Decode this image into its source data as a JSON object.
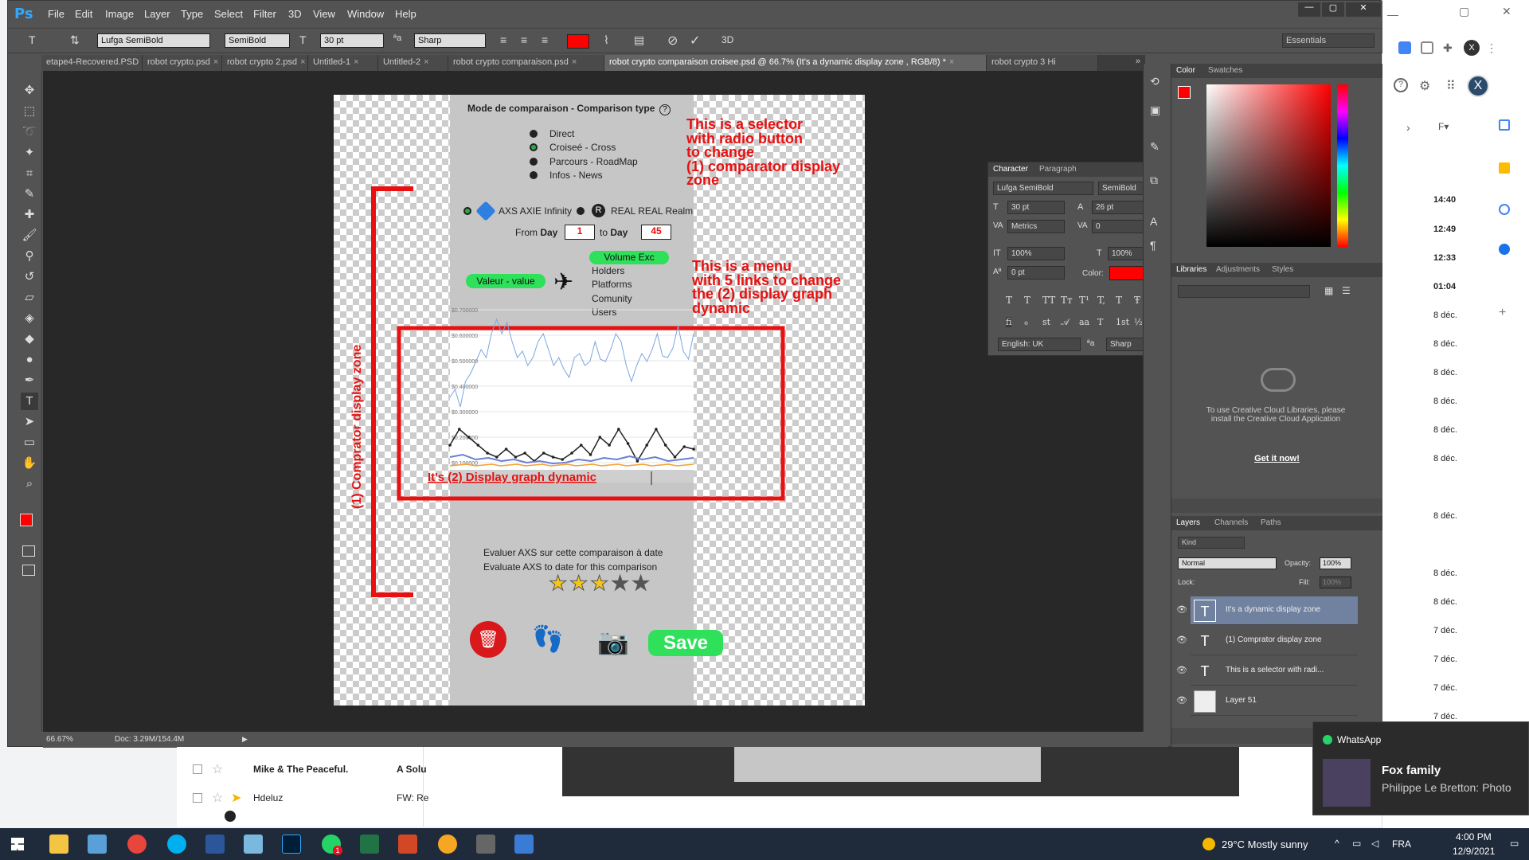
{
  "ps": {
    "logo": "Ps",
    "menu": [
      "File",
      "Edit",
      "Image",
      "Layer",
      "Type",
      "Select",
      "Filter",
      "3D",
      "View",
      "Window",
      "Help"
    ],
    "window_controls": [
      "—",
      "▢",
      "✕"
    ],
    "options": {
      "font_family": "Lufga SemiBold",
      "font_style": "SemiBold",
      "font_size": "30 pt",
      "aa_label": "ªa",
      "aa": "Sharp",
      "workspace": "Essentials",
      "threed": "3D"
    },
    "tabs": [
      "etape4-Recovered.PSD",
      "robot crypto.psd",
      "robot crypto 2.psd",
      "Untitled-1",
      "Untitled-2",
      "robot crypto comparaison.psd",
      "robot crypto comparaison croisee.psd @ 66.7% (It's a dynamic display zone , RGB/8) *",
      "robot crypto 3 Hi"
    ],
    "tab_close": "×",
    "tab_more": "»",
    "status": {
      "zoom": "66.67%",
      "doc": "Doc: 3.29M/154.4M"
    }
  },
  "doc": {
    "header": "Mode de comparaison - Comparison type",
    "help": "?",
    "radios": [
      "Direct",
      "Croiseé - Cross",
      "Parcours - RoadMap",
      "Infos - News"
    ],
    "assets": {
      "a": "AXS AXIE Infinity",
      "b": "REAL REAL Realm"
    },
    "from_label": "From",
    "day_label": "Day",
    "from_val": "1",
    "to_label": "to",
    "to_val": "45",
    "value_pill": "Valeur - value",
    "menu_links": [
      "Volume Exc",
      "Holders",
      "Platforms",
      "Comunity",
      "Users"
    ],
    "yticks": [
      "$0.700000",
      "$0.600000",
      "$0.500000",
      "$0.400000",
      "$0.300000",
      "$0.200000",
      "$0.100000"
    ],
    "graph_text": "It's (2) Display graph dynamic",
    "eval1": "Evaluer AXS sur cette comparaison à date",
    "eval2": "Evaluate AXS to date for this comparison",
    "rating": 3,
    "save": "Save",
    "ann_selector": [
      "This is a selector",
      "with radio button",
      "to change",
      "(1) comparator display",
      "zone"
    ],
    "ann_menu": [
      "This is a menu",
      "with 5 links to change",
      "the  (2) display graph",
      "dynamic"
    ],
    "ann_vertical": "(1) Comprator display zone"
  },
  "char_panel": {
    "tabs": [
      "Character",
      "Paragraph"
    ],
    "font": "Lufga SemiBold",
    "style": "SemiBold",
    "size": "30 pt",
    "leading": "26 pt",
    "kerning": "Metrics",
    "tracking": "0",
    "vscale": "100%",
    "hscale": "100%",
    "baseline": "0 pt",
    "color_label": "Color:",
    "lang": "English: UK",
    "aa": "Sharp"
  },
  "right": {
    "color_tabs": [
      "Color",
      "Swatches"
    ],
    "lib_tabs": [
      "Libraries",
      "Adjustments",
      "Styles"
    ],
    "lib_msg": "To use Creative Cloud Libraries, please install the Creative Cloud Application",
    "lib_link": "Get it now!",
    "layer_tabs": [
      "Layers",
      "Channels",
      "Paths"
    ],
    "kind": "Kind",
    "blend": "Normal",
    "opacity_label": "Opacity:",
    "opacity": "100%",
    "lock_label": "Lock:",
    "fill_label": "Fill:",
    "fill": "100%",
    "layers": [
      "It's a dynamic display zone",
      "(1) Comprator display zone",
      "This is a selector  with radi...",
      "Layer 51"
    ]
  },
  "browser": {
    "times": [
      "14:40",
      "12:49",
      "12:33",
      "01:04",
      "8 déc.",
      "8 déc.",
      "8 déc.",
      "8 déc.",
      "8 déc.",
      "8 déc.",
      "8 déc.",
      "8 déc.",
      "8 déc.",
      "7 déc.",
      "7 déc.",
      "7 déc.",
      "7 déc."
    ],
    "avatar": "X",
    "font_tool": "F▾"
  },
  "gmail": {
    "rows": [
      {
        "from": "Mike & The Peaceful.",
        "subj": "A Solu"
      },
      {
        "from": "Hdeluz",
        "subj": "FW: Re"
      }
    ]
  },
  "whatsapp": {
    "app": "WhatsApp",
    "title": "Fox family",
    "msg": "Philippe Le Bretton: Photo"
  },
  "taskbar": {
    "weather": "29°C  Mostly sunny",
    "lang": "FRA",
    "time": "4:00 PM",
    "date": "12/9/2021",
    "badge": "1",
    "chevron": "^"
  }
}
